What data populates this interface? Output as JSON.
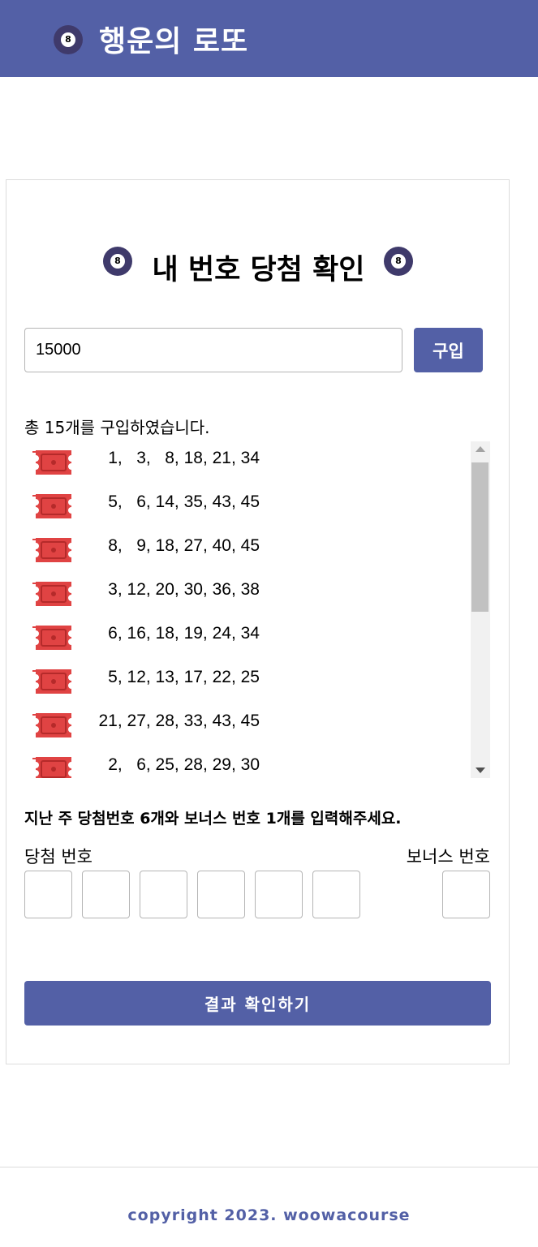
{
  "colors": {
    "primary": "#5360a6",
    "ball": "#3f3a6b",
    "ticket": "#e04343"
  },
  "header": {
    "title": "행운의 로또",
    "icon": "8-ball-icon",
    "ball_number": "8"
  },
  "main": {
    "title": "내 번호 당첨 확인",
    "ball_number": "8",
    "purchase": {
      "amount_value": "15000",
      "buy_label": "구입"
    },
    "ticket_count_text": "총 15개를 구입하였습니다.",
    "tickets": [
      "1,   3,   8, 18, 21, 34",
      "5,   6, 14, 35, 43, 45",
      "8,   9, 18, 27, 40, 45",
      "3, 12, 20, 30, 36, 38",
      "6, 16, 18, 19, 24, 34",
      "5, 12, 13, 17, 22, 25",
      "21, 27, 28, 33, 43, 45",
      "2,   6, 25, 28, 29, 30"
    ],
    "instruction": "지난 주 당첨번호 6개와 보너스 번호 1개를 입력해주세요.",
    "winning_label": "당첨 번호",
    "bonus_label": "보너스 번호",
    "result_label": "결과 확인하기"
  },
  "footer": {
    "copyright": "copyright 2023. woowacourse"
  }
}
